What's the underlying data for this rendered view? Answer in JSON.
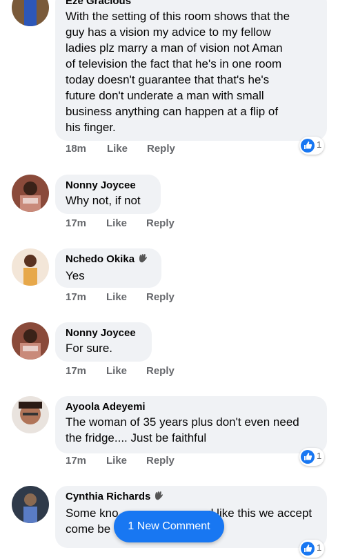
{
  "comments": [
    {
      "name": "Eze Gracious",
      "text_lines": [
        "With the setting of this room shows that the",
        "guy has  a vision my advice to my fellow",
        "ladies plz marry a man of vision not Aman",
        "of television the fact that he's in one room",
        "today doesn't guarantee that that's he's",
        "future don't underate a man with small",
        "business anything can happen at a flip of",
        "his finger."
      ],
      "time": "18m",
      "like": "Like",
      "reply": "Reply",
      "reactions": "1"
    },
    {
      "name": "Nonny Joycee",
      "text_lines": [
        "Why not, if not"
      ],
      "time": "17m",
      "like": "Like",
      "reply": "Reply"
    },
    {
      "name": "Nchedo Okika",
      "text_lines": [
        "Yes"
      ],
      "time": "17m",
      "like": "Like",
      "reply": "Reply"
    },
    {
      "name": "Nonny Joycee",
      "text_lines": [
        "For sure."
      ],
      "time": "17m",
      "like": "Like",
      "reply": "Reply"
    },
    {
      "name": "Ayoola Adeyemi",
      "text_lines": [
        "The woman of 35 years plus don't even need",
        "the fridge.... Just be faithful"
      ],
      "time": "17m",
      "like": "Like",
      "reply": "Reply",
      "reactions": "1"
    },
    {
      "name": "Cynthia Richards",
      "text_lines": [
        "Some kno",
        "come be"
      ],
      "line_tails": [
        "d like this we accept e",
        ""
      ],
      "reactions": "1"
    }
  ],
  "new_comment_button": "1 New Comment",
  "colors": {
    "bubble": "#f0f2f5",
    "accent": "#1877f2",
    "meta": "#65676b"
  }
}
